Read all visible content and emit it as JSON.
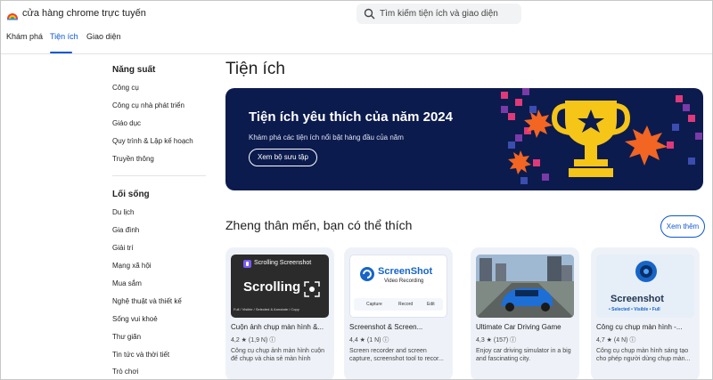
{
  "header": {
    "store_name": "cửa hàng chrome trực tuyến",
    "search_placeholder": "Tìm kiếm tiện ích và giao diện",
    "nav": [
      "Khám phá",
      "Tiện ích",
      "Giao diện"
    ]
  },
  "sidebar": {
    "groups": [
      {
        "heading": "Năng suất",
        "items": [
          "Công cụ",
          "Công cụ nhà phát triển",
          "Giáo dục",
          "Quy trình & Lập kế hoạch",
          "Truyền thông"
        ]
      },
      {
        "heading": "Lối sống",
        "items": [
          "Du lịch",
          "Gia đình",
          "Giải trí",
          "Mạng xã hội",
          "Mua sắm",
          "Nghệ thuật và thiết kế",
          "Sống vui khoẻ",
          "Thư giãn",
          "Tin tức và thời tiết",
          "Trò chơi"
        ]
      }
    ]
  },
  "main": {
    "page_title": "Tiện ích",
    "banner": {
      "title": "Tiện ích yêu thích của năm 2024",
      "subtitle": "Khám phá các tiện ích nổi bật hàng đầu của năm",
      "button": "Xem bộ sưu tập"
    },
    "section_title": "Zheng thân mến, bạn có thể thích",
    "more_button": "Xem thêm",
    "cards": [
      {
        "name": "Cuộn ảnh chụp màn hình &...",
        "rating": "4,2 ★ (1,9 N) ⓘ",
        "desc": "Công cụ chụp ảnh màn hình cuộn để chụp và chia sẻ màn hình",
        "thumb_title": "Scrolling Screenshot",
        "thumb_big": "Scrolling",
        "thumb_foot": "Full / Visible / Selected & Annotate / Copy"
      },
      {
        "name": "Screenshot & Screen...",
        "rating": "4,4 ★ (1 N) ⓘ",
        "desc": "Screen recorder and screen capture, screenshot tool to recor...",
        "thumb_title": "ScreenShot",
        "thumb_sub": "Video Recording",
        "thumb_tools": [
          "Capture",
          "Record",
          "Edit"
        ]
      },
      {
        "name": "Ultimate Car Driving Game",
        "rating": "4,3 ★ (157) ⓘ",
        "desc": "Enjoy car driving simulator in a big and fascinating city."
      },
      {
        "name": "Công cụ chụp màn hình -...",
        "rating": "4,7 ★ (4 N) ⓘ",
        "desc": "Công cụ chụp màn hình sáng tạo cho phép người dùng chụp màn...",
        "thumb_title": "Screenshot",
        "thumb_sub": "• Selected   • Visible   • Full"
      }
    ]
  },
  "colors": {
    "accent": "#0b57d0",
    "banner_bg": "#0c1b4d",
    "card_bg": "#eef2f8",
    "trophy_gold": "#f5c518",
    "burst_orange": "#f26522"
  }
}
